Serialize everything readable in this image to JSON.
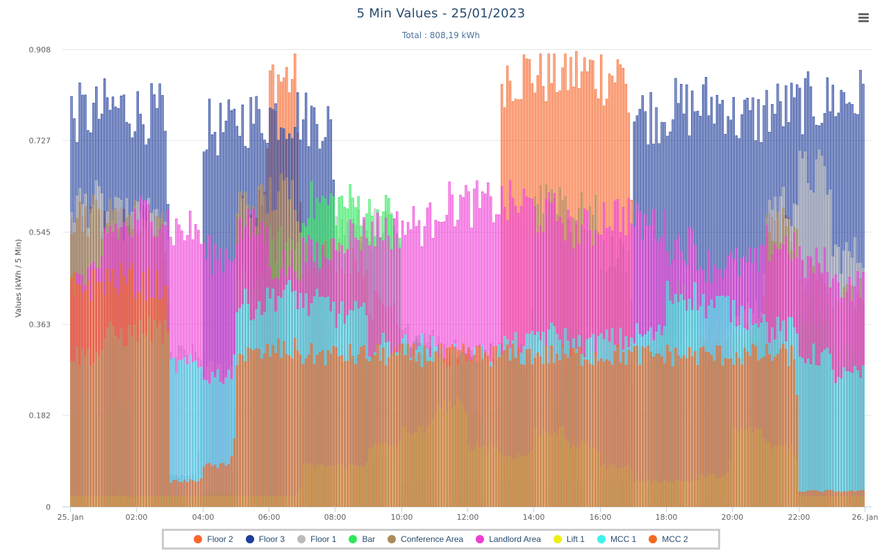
{
  "header": {
    "title": "5 Min Values - 25/01/2023",
    "subtitle": "Total : 808,19 kWh",
    "menu_icon": "hamburger-menu-icon"
  },
  "chart_data": {
    "type": "bar",
    "title": "5 Min Values - 25/01/2023",
    "subtitle": "Total : 808,19 kWh",
    "xlabel": "",
    "ylabel": "Values (kWh / 5 Min)",
    "ylim": [
      0,
      0.908
    ],
    "yticks": [
      "0",
      "0.182",
      "0.363",
      "0.545",
      "0.727",
      "0.908"
    ],
    "ytick_values": [
      0,
      0.182,
      0.363,
      0.545,
      0.727,
      0.908
    ],
    "xticks": [
      "25. Jan",
      "02:00",
      "04:00",
      "06:00",
      "08:00",
      "10:00",
      "12:00",
      "14:00",
      "16:00",
      "18:00",
      "20:00",
      "22:00",
      "26. Jan"
    ],
    "xtick_hours": [
      0,
      2,
      4,
      6,
      8,
      10,
      12,
      14,
      16,
      18,
      20,
      22,
      24
    ],
    "interval_minutes": 5,
    "points_per_series": 288,
    "grid": true,
    "legend_position": "bottom-center",
    "note": "Overlapping (non-stacked) columns; values are approximate hourly levels per series read from the figure (kWh per 5 min), index = hour 0..23",
    "series": [
      {
        "name": "Floor 2",
        "color": "#f7672c",
        "hourly": [
          0.56,
          0.56,
          0.56,
          0.02,
          0.03,
          0.6,
          0.85,
          0.0,
          0.01,
          0.01,
          0.01,
          0.01,
          0.01,
          0.86,
          0.86,
          0.86,
          0.86,
          0.02,
          0.01,
          0.01,
          0.01,
          0.55,
          0.02,
          0.02
        ]
      },
      {
        "name": "Floor 3",
        "color": "#1f3d99",
        "hourly": [
          0.78,
          0.79,
          0.78,
          0.06,
          0.75,
          0.77,
          0.78,
          0.77,
          0.3,
          0.1,
          0.05,
          0.05,
          0.05,
          0.05,
          0.05,
          0.05,
          0.05,
          0.78,
          0.79,
          0.8,
          0.77,
          0.79,
          0.8,
          0.81
        ]
      },
      {
        "name": "Floor 1",
        "color": "#bbbbbb",
        "hourly": [
          0.6,
          0.57,
          0.57,
          0.3,
          0.27,
          0.3,
          0.3,
          0.4,
          0.55,
          0.55,
          0.34,
          0.32,
          0.3,
          0.3,
          0.32,
          0.32,
          0.3,
          0.33,
          0.33,
          0.35,
          0.38,
          0.6,
          0.66,
          0.5
        ]
      },
      {
        "name": "Bar",
        "color": "#2ee85a",
        "hourly": [
          0.2,
          0.2,
          0.42,
          0.02,
          0.03,
          0.44,
          0.52,
          0.6,
          0.6,
          0.58,
          0.32,
          0.3,
          0.18,
          0.28,
          0.22,
          0.33,
          0.05,
          0.32,
          0.42,
          0.3,
          0.34,
          0.3,
          0.38,
          0.3
        ]
      },
      {
        "name": "Conference Area",
        "color": "#ad8b5d",
        "hourly": [
          0.58,
          0.57,
          0.57,
          0.02,
          0.02,
          0.6,
          0.62,
          0.5,
          0.5,
          0.4,
          0.3,
          0.28,
          0.3,
          0.3,
          0.62,
          0.58,
          0.5,
          0.3,
          0.3,
          0.32,
          0.34,
          0.55,
          0.46,
          0.42
        ]
      },
      {
        "name": "Landlord Area",
        "color": "#ef3dd6",
        "hourly": [
          0.45,
          0.55,
          0.58,
          0.55,
          0.5,
          0.55,
          0.48,
          0.5,
          0.54,
          0.55,
          0.56,
          0.6,
          0.6,
          0.6,
          0.58,
          0.55,
          0.58,
          0.56,
          0.52,
          0.48,
          0.48,
          0.52,
          0.48,
          0.44
        ]
      },
      {
        "name": "Lift 1",
        "color": "#eeee11",
        "hourly": [
          0.02,
          0.02,
          0.02,
          0.02,
          0.02,
          0.02,
          0.02,
          0.08,
          0.08,
          0.12,
          0.15,
          0.2,
          0.12,
          0.1,
          0.15,
          0.12,
          0.08,
          0.05,
          0.05,
          0.06,
          0.15,
          0.12,
          0.02,
          0.02
        ]
      },
      {
        "name": "MCC 1",
        "color": "#3ef2ec",
        "hourly": [
          0.3,
          0.34,
          0.35,
          0.28,
          0.26,
          0.4,
          0.42,
          0.4,
          0.38,
          0.32,
          0.32,
          0.3,
          0.3,
          0.32,
          0.34,
          0.32,
          0.33,
          0.34,
          0.42,
          0.4,
          0.38,
          0.35,
          0.3,
          0.26
        ]
      },
      {
        "name": "MCC 2",
        "color": "#f36a23",
        "hourly": [
          0.44,
          0.45,
          0.44,
          0.05,
          0.08,
          0.3,
          0.31,
          0.3,
          0.3,
          0.3,
          0.3,
          0.3,
          0.3,
          0.3,
          0.3,
          0.3,
          0.3,
          0.3,
          0.3,
          0.3,
          0.3,
          0.3,
          0.03,
          0.03
        ]
      }
    ]
  },
  "legend": {
    "items": [
      {
        "label": "Floor 2",
        "color": "#f7672c"
      },
      {
        "label": "Floor 3",
        "color": "#1f3d99"
      },
      {
        "label": "Floor 1",
        "color": "#bbbbbb"
      },
      {
        "label": "Bar",
        "color": "#2ee85a"
      },
      {
        "label": "Conference Area",
        "color": "#ad8b5d"
      },
      {
        "label": "Landlord Area",
        "color": "#ef3dd6"
      },
      {
        "label": "Lift 1",
        "color": "#eeee11"
      },
      {
        "label": "MCC 1",
        "color": "#3ef2ec"
      },
      {
        "label": "MCC 2",
        "color": "#f36a23"
      }
    ]
  }
}
